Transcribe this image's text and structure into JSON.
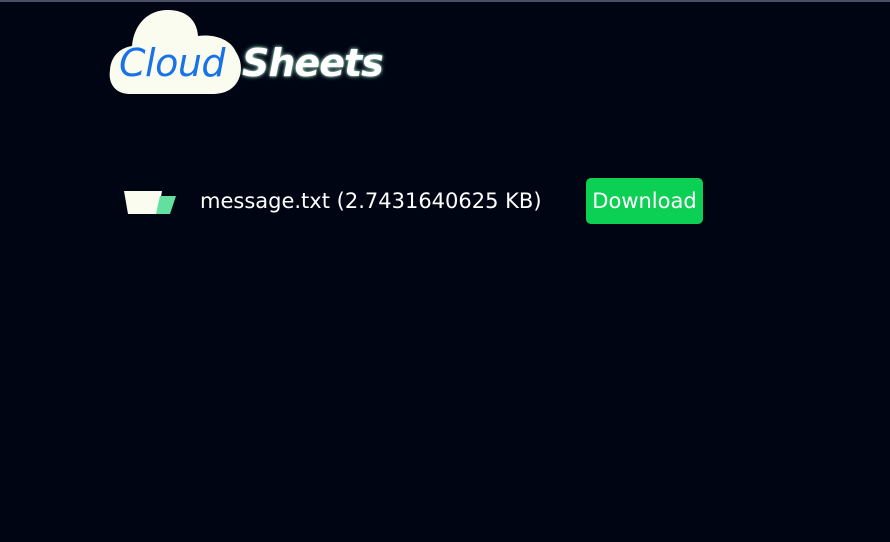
{
  "brand": {
    "cloud_text": "Cloud",
    "sheets_text": "Sheets",
    "cloud_color": "#1a72e8",
    "sheets_color": "#ffffff",
    "logo_background": "#fbfcf0"
  },
  "file": {
    "name": "message.txt",
    "size": "(2.7431640625 KB)",
    "icon": "folder-icon"
  },
  "actions": {
    "download_label": "Download",
    "download_color": "#0cd054"
  },
  "theme": {
    "background": "#000514"
  }
}
